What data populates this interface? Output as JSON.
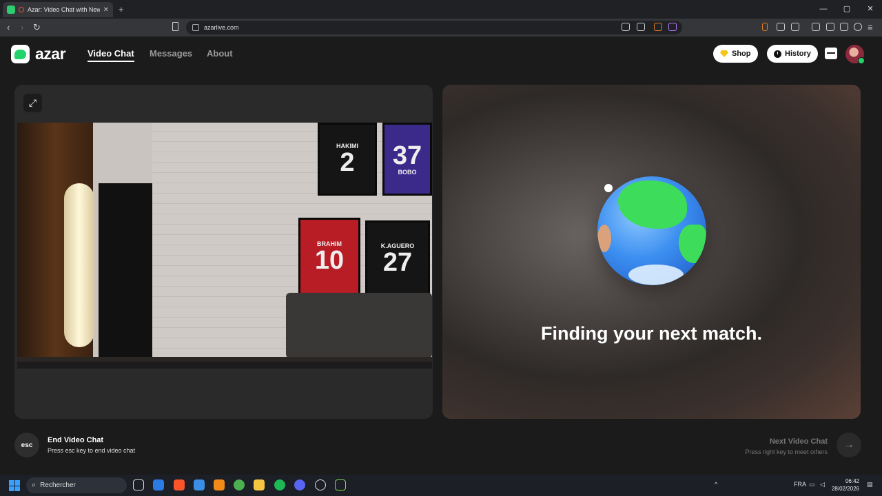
{
  "browser": {
    "tab_title": "Azar: Video Chat with New Pe",
    "tab_close": "✕",
    "new_tab": "+",
    "url": "azarlive.com",
    "window_controls": [
      "—",
      "▢",
      "✕"
    ]
  },
  "app": {
    "logo_text": "azar",
    "nav": [
      {
        "label": "Video Chat",
        "active": true
      },
      {
        "label": "Messages",
        "active": false
      },
      {
        "label": "About",
        "active": false
      }
    ],
    "shop_label": "Shop",
    "history_label": "History"
  },
  "local_video": {
    "jerseys": [
      {
        "name": "HAKIMI",
        "number": "2"
      },
      {
        "name": "BOBO",
        "number": "37"
      },
      {
        "name": "BRAHIM",
        "number": "10"
      },
      {
        "name": "K.AGUERO",
        "number": "27"
      }
    ]
  },
  "remote": {
    "status_text": "Finding your next match."
  },
  "footer": {
    "esc_key": "esc",
    "end_title": "End Video Chat",
    "end_sub": "Press esc key to end video chat",
    "next_title": "Next Video Chat",
    "next_sub": "Press right key to meet others"
  },
  "taskbar": {
    "search_placeholder": "Rechercher",
    "language": "FRA",
    "time": "06:42",
    "date": "28/02/2026"
  },
  "colors": {
    "accent": "#22d36b",
    "background": "#1b1b1b",
    "panel": "#2a2a2a"
  }
}
